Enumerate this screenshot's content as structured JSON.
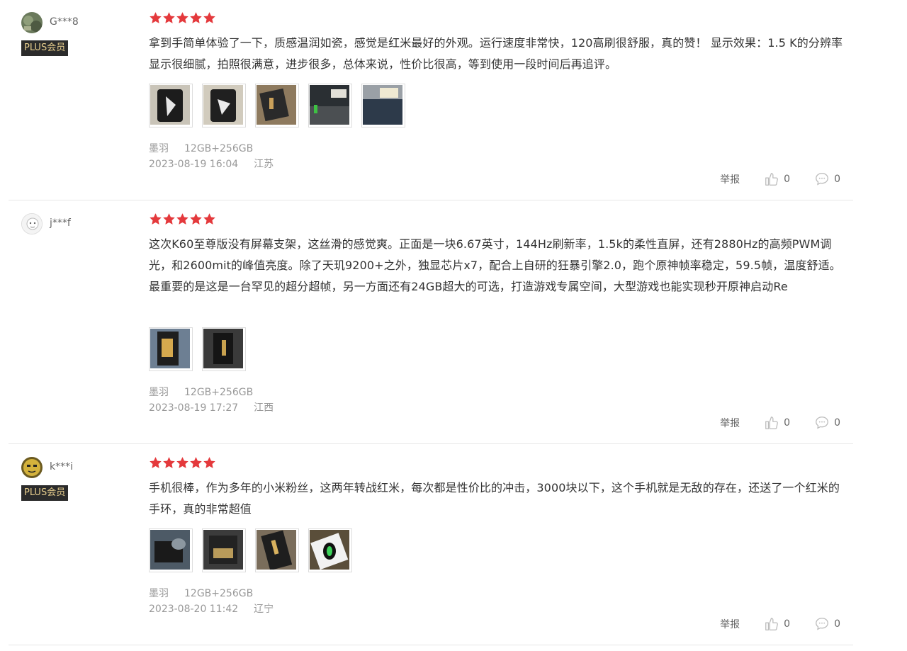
{
  "reviews": [
    {
      "username": "G***8",
      "badge": "PLUS会员",
      "rating": 5,
      "text": "拿到手简单体验了一下，质感温润如瓷，感觉是红米最好的外观。运行速度非常快，120高刷很舒服，真的赞！ 显示效果：1.5 K的分辨率显示很细腻，拍照很满意，进步很多，总体来说，性价比很高，等到使用一段时间后再追评。",
      "variant": "墨羽",
      "spec": "12GB+256GB",
      "date": "2023-08-19 16:04",
      "location": "江苏",
      "report_label": "举报",
      "likes": "0",
      "comments": "0"
    },
    {
      "username": "j***f",
      "badge": "",
      "rating": 5,
      "text": "这次K60至尊版没有屏幕支架，这丝滑的感觉爽。正面是一块6.67英寸，144Hz刷新率，1.5k的柔性直屏，还有2880Hz的高频PWM调光，和2600mit的峰值亮度。除了天玑9200+之外，独显芯片x7，配合上自研的狂暴引擎2.0，跑个原神帧率稳定，59.5帧，温度舒适。最重要的是这是一台罕见的超分超帧，另一方面还有24GB超大的可选，打造游戏专属空间，大型游戏也能实现秒开原神启动Re",
      "variant": "墨羽",
      "spec": "12GB+256GB",
      "date": "2023-08-19 17:27",
      "location": "江西",
      "report_label": "举报",
      "likes": "0",
      "comments": "0"
    },
    {
      "username": "k***i",
      "badge": "PLUS会员",
      "rating": 5,
      "text": "手机很棒，作为多年的小米粉丝，这两年转战红米，每次都是性价比的冲击，3000块以下，这个手机就是无敌的存在，还送了一个红米的手环，真的非常超值",
      "variant": "墨羽",
      "spec": "12GB+256GB",
      "date": "2023-08-20 11:42",
      "location": "辽宁",
      "report_label": "举报",
      "likes": "0",
      "comments": "0"
    }
  ],
  "colors": {
    "star": "#e4393c",
    "badge_bg": "#2b2b2b",
    "badge_text": "#e8cf8e",
    "muted": "#999999"
  }
}
